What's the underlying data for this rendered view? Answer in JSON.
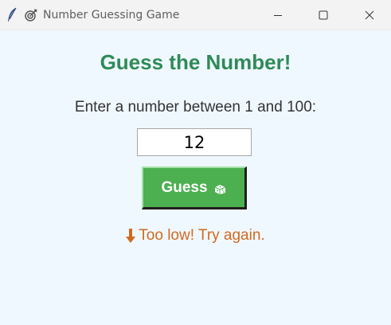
{
  "window": {
    "title": "Number Guessing Game",
    "icons": [
      "feather-icon",
      "target-icon"
    ],
    "controls": [
      "minimize-icon",
      "maximize-icon",
      "close-icon"
    ]
  },
  "game": {
    "heading": "Guess the Number!",
    "prompt": "Enter a number between 1 and 100:",
    "input_value": "12",
    "guess_button_label": "Guess",
    "guess_button_icon": "dice-icon",
    "feedback_icon": "down-arrow-icon",
    "feedback_text": "Too low! Try again."
  },
  "colors": {
    "background": "#f0f8ff",
    "heading": "#2e8b57",
    "button": "#4caf50",
    "feedback": "#d2691e"
  }
}
